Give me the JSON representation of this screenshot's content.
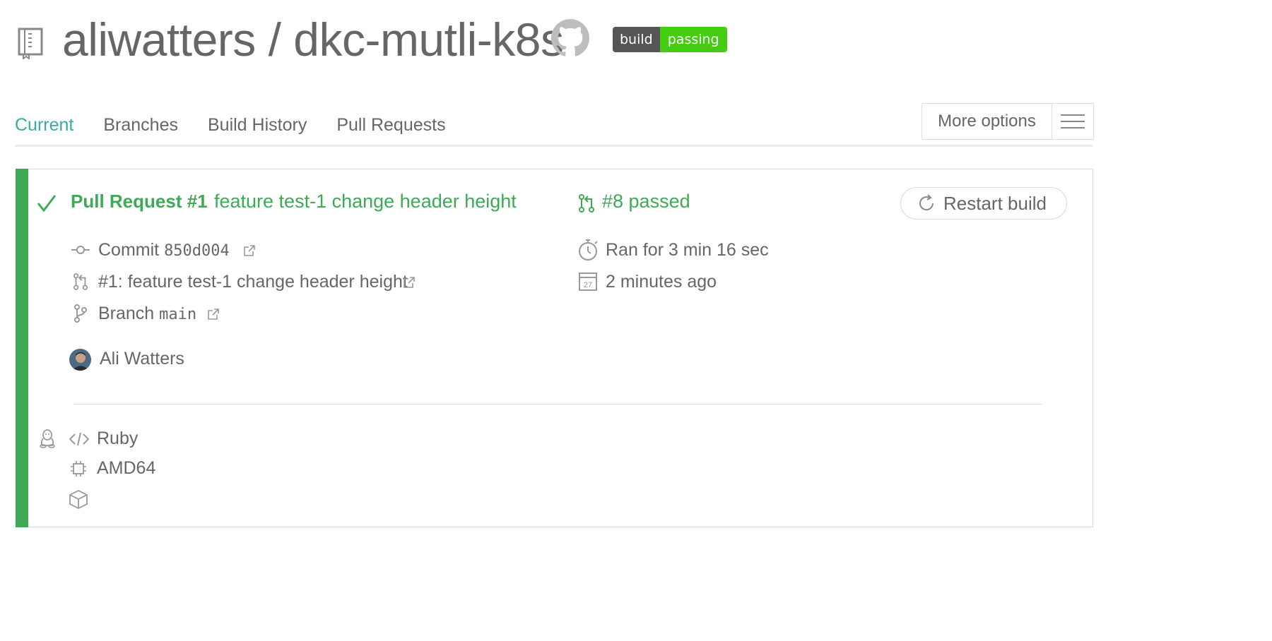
{
  "header": {
    "repo_title": "aliwatters / dkc-mutli-k8s",
    "badge_left": "build",
    "badge_right": "passing"
  },
  "tabs": [
    {
      "label": "Current",
      "active": true
    },
    {
      "label": "Branches",
      "active": false
    },
    {
      "label": "Build History",
      "active": false
    },
    {
      "label": "Pull Requests",
      "active": false
    }
  ],
  "more_options_label": "More options",
  "build": {
    "status": "passed",
    "pr_label": "Pull Request #1",
    "pr_title": "feature test-1 change header height",
    "build_number": "#8 passed",
    "restart_label": "Restart build",
    "commit_label": "Commit",
    "commit_sha": "850d004",
    "pr_link": "#1: feature test-1 change header height",
    "branch_label": "Branch",
    "branch_name": "main",
    "duration": "Ran for 3 min 16 sec",
    "finished": "2 minutes ago",
    "calendar_day": "27",
    "author": "Ali Watters"
  },
  "job_meta": {
    "language": "Ruby",
    "arch": "AMD64"
  },
  "colors": {
    "passed": "#3eaa56",
    "tab_active": "#39aaa4",
    "badge_green": "#44cc11",
    "badge_grey": "#555555"
  },
  "icons": [
    "repo-icon",
    "github-icon",
    "check-icon",
    "pull-request-icon",
    "restart-icon",
    "commit-icon",
    "external-link-icon",
    "branch-icon",
    "stopwatch-icon",
    "calendar-icon",
    "linux-icon",
    "code-icon",
    "cpu-icon",
    "box-icon",
    "menu-icon"
  ]
}
